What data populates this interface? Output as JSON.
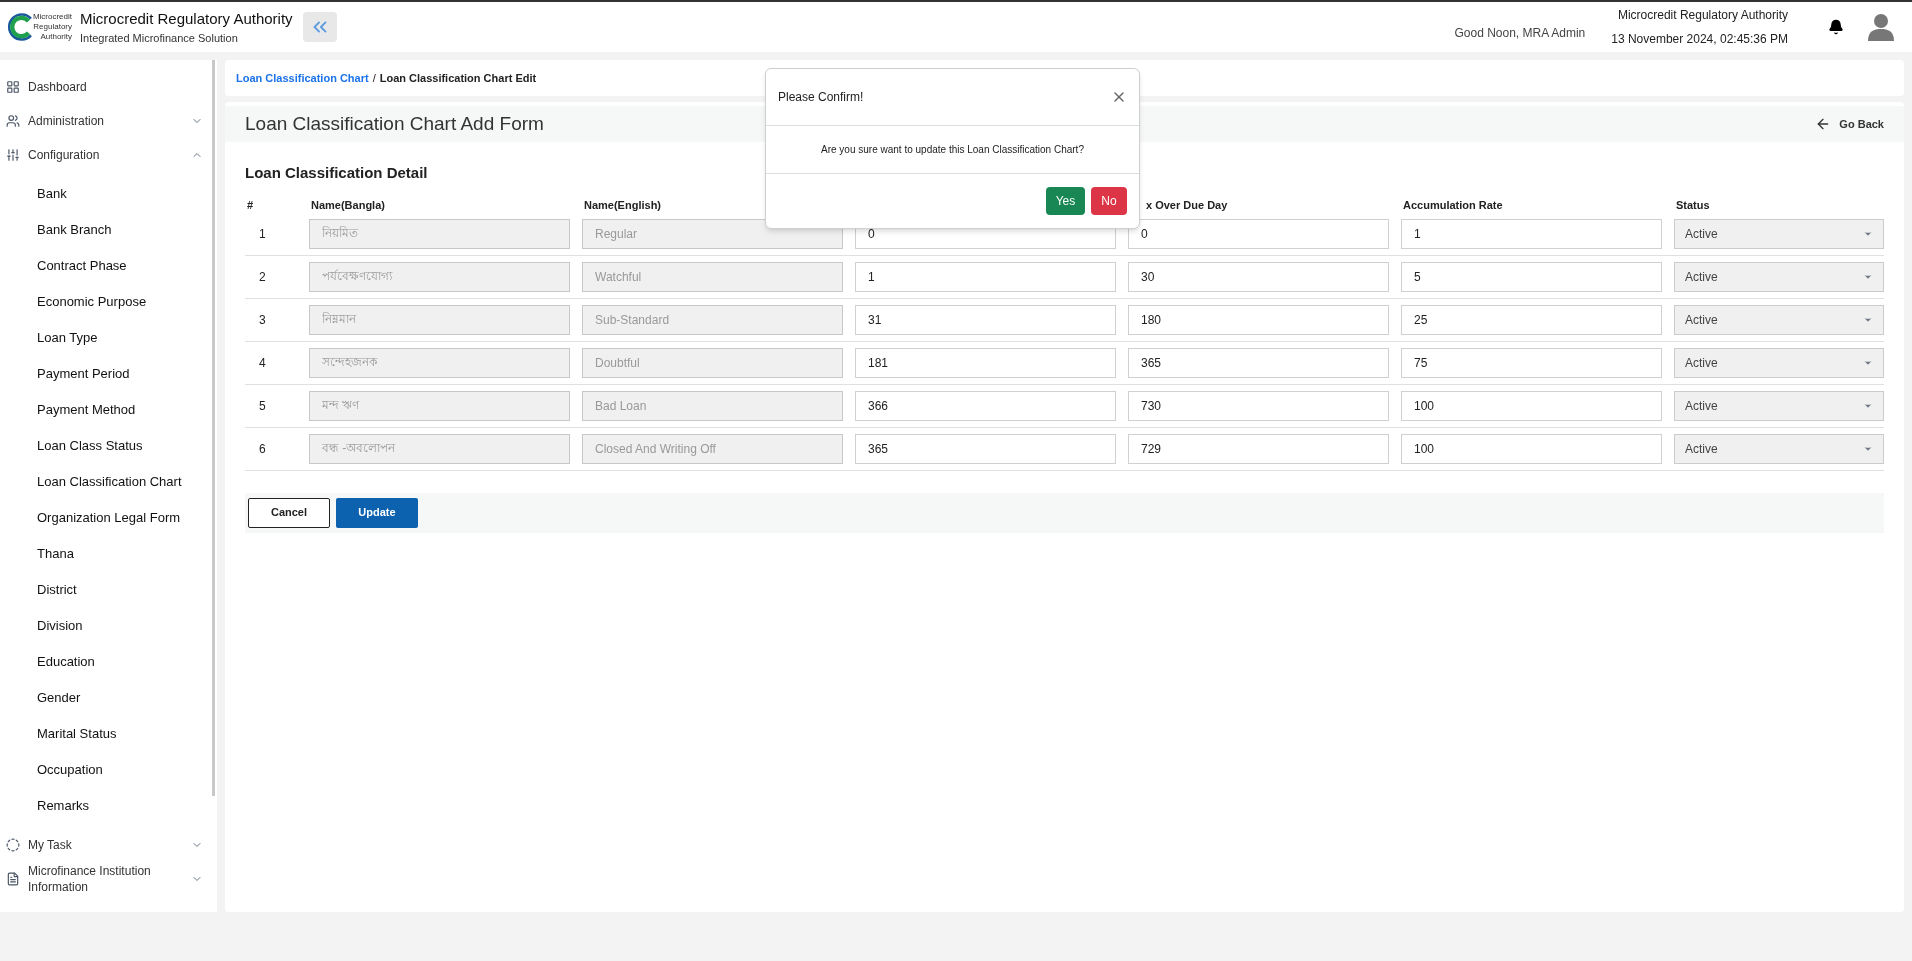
{
  "header": {
    "org_name": "Microcredit Regulatory Authority",
    "subtitle": "Integrated Microfinance Solution",
    "logo_text": [
      "Microcredit",
      "Regulatory",
      "Authority"
    ],
    "greeting": "Good Noon, MRA Admin",
    "org_name_right": "Microcredit Regulatory Authority",
    "datetime": "13 November 2024, 02:45:36 PM"
  },
  "sidebar": {
    "items": [
      {
        "label": "Dashboard",
        "kind": "dashboard"
      },
      {
        "label": "Administration",
        "kind": "admin",
        "expanded": false
      },
      {
        "label": "Configuration",
        "kind": "config",
        "expanded": true,
        "children": [
          {
            "label": "Bank"
          },
          {
            "label": "Bank Branch"
          },
          {
            "label": "Contract Phase"
          },
          {
            "label": "Economic Purpose"
          },
          {
            "label": "Loan Type"
          },
          {
            "label": "Payment Period"
          },
          {
            "label": "Payment Method"
          },
          {
            "label": "Loan Class Status"
          },
          {
            "label": "Loan Classification Chart"
          },
          {
            "label": "Organization Legal Form"
          },
          {
            "label": "Thana"
          },
          {
            "label": "District"
          },
          {
            "label": "Division"
          },
          {
            "label": "Education"
          },
          {
            "label": "Gender"
          },
          {
            "label": "Marital Status"
          },
          {
            "label": "Occupation"
          },
          {
            "label": "Remarks"
          }
        ]
      },
      {
        "label": "My Task",
        "kind": "task",
        "expanded": false
      },
      {
        "label": "Microfinance Institution Information",
        "kind": "institution",
        "expanded": false
      }
    ]
  },
  "breadcrumb": {
    "link": "Loan Classification Chart",
    "separator": "/",
    "current": "Loan Classification Chart Edit"
  },
  "form": {
    "title": "Loan Classification Chart Add Form",
    "go_back": "Go Back",
    "section_title": "Loan Classification Detail",
    "columns": [
      {
        "label": "#"
      },
      {
        "label": "Name(Bangla)",
        "disabled": true
      },
      {
        "label": "Name(English)",
        "disabled": true
      },
      {},
      {
        "label": "x Over Due Day",
        "disabled": false
      },
      {
        "label": "Accumulation Rate",
        "disabled": false
      },
      {
        "label": "Status"
      }
    ],
    "rows": [
      {
        "no": "1",
        "name_bn": "নিয়মিত",
        "name_en": "Regular",
        "column_3": "0",
        "over_due": "0",
        "rate": "1",
        "status": "Active"
      },
      {
        "no": "2",
        "name_bn": "পর্যবেক্ষণযোগ্য",
        "name_en": "Watchful",
        "column_3": "1",
        "over_due": "30",
        "rate": "5",
        "status": "Active"
      },
      {
        "no": "3",
        "name_bn": "নিম্নমান",
        "name_en": "Sub-Standard",
        "column_3": "31",
        "over_due": "180",
        "rate": "25",
        "status": "Active"
      },
      {
        "no": "4",
        "name_bn": "সন্দেহজনক",
        "name_en": "Doubtful",
        "column_3": "181",
        "over_due": "365",
        "rate": "75",
        "status": "Active"
      },
      {
        "no": "5",
        "name_bn": "মন্দ ঋণ",
        "name_en": "Bad Loan",
        "column_3": "366",
        "over_due": "730",
        "rate": "100",
        "status": "Active"
      },
      {
        "no": "6",
        "name_bn": "বন্ধ -অবলোপন",
        "name_en": "Closed And Writing Off",
        "column_3": "365",
        "over_due": "729",
        "rate": "100",
        "status": "Active"
      }
    ],
    "buttons": {
      "cancel": "Cancel",
      "update": "Update"
    }
  },
  "dialog": {
    "title": "Please Confirm!",
    "message": "Are you sure want to update this Loan Classification Chart?",
    "yes": "Yes",
    "no": "No"
  }
}
